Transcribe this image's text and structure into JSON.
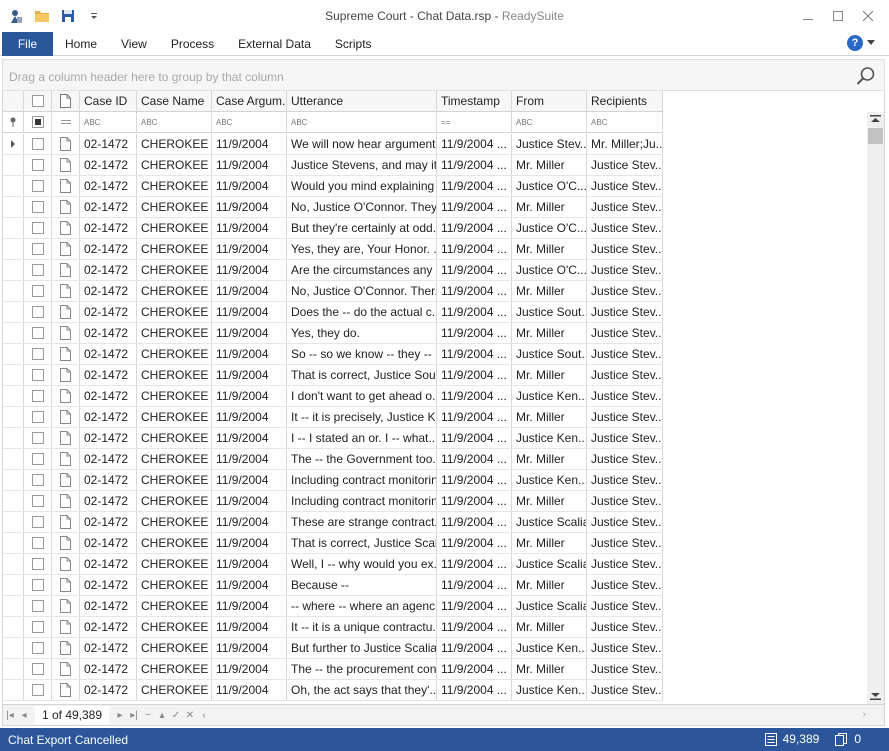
{
  "window": {
    "title": "Supreme Court - Chat Data.rsp",
    "app_name": "ReadySuite"
  },
  "ribbon": {
    "file_label": "File",
    "tabs": [
      "Home",
      "View",
      "Process",
      "External Data",
      "Scripts"
    ]
  },
  "group_panel": {
    "hint": "Drag a column header here to group by that column"
  },
  "grid": {
    "columns": [
      "Case ID",
      "Case Name",
      "Case Argum...",
      "Utterance",
      "Timestamp",
      "From",
      "Recipients"
    ],
    "filter_glyphs": [
      "ABC",
      "ABC",
      "ABC",
      "ABC",
      "==",
      "ABC",
      "ABC"
    ],
    "rows": [
      {
        "id": "02-1472",
        "name": "CHEROKEE ...",
        "date": "11/9/2004",
        "utterance": "We will now hear argument ...",
        "ts": "11/9/2004 ...",
        "from": "Justice Stev...",
        "to": "Mr. Miller;Ju..."
      },
      {
        "id": "02-1472",
        "name": "CHEROKEE ...",
        "date": "11/9/2004",
        "utterance": "Justice Stevens, and may it...",
        "ts": "11/9/2004 ...",
        "from": "Mr. Miller",
        "to": "Justice Stev..."
      },
      {
        "id": "02-1472",
        "name": "CHEROKEE ...",
        "date": "11/9/2004",
        "utterance": "Would you mind explaining ...",
        "ts": "11/9/2004 ...",
        "from": "Justice O'C...",
        "to": "Justice Stev..."
      },
      {
        "id": "02-1472",
        "name": "CHEROKEE ...",
        "date": "11/9/2004",
        "utterance": "No, Justice O'Connor. They...",
        "ts": "11/9/2004 ...",
        "from": "Mr. Miller",
        "to": "Justice Stev..."
      },
      {
        "id": "02-1472",
        "name": "CHEROKEE ...",
        "date": "11/9/2004",
        "utterance": "But they're certainly at odd...",
        "ts": "11/9/2004 ...",
        "from": "Justice O'C...",
        "to": "Justice Stev..."
      },
      {
        "id": "02-1472",
        "name": "CHEROKEE ...",
        "date": "11/9/2004",
        "utterance": "Yes, they are, Your Honor. ...",
        "ts": "11/9/2004 ...",
        "from": "Mr. Miller",
        "to": "Justice Stev..."
      },
      {
        "id": "02-1472",
        "name": "CHEROKEE ...",
        "date": "11/9/2004",
        "utterance": "Are the circumstances any ...",
        "ts": "11/9/2004 ...",
        "from": "Justice O'C...",
        "to": "Justice Stev..."
      },
      {
        "id": "02-1472",
        "name": "CHEROKEE ...",
        "date": "11/9/2004",
        "utterance": "No, Justice O'Connor. Ther...",
        "ts": "11/9/2004 ...",
        "from": "Mr. Miller",
        "to": "Justice Stev..."
      },
      {
        "id": "02-1472",
        "name": "CHEROKEE ...",
        "date": "11/9/2004",
        "utterance": "Does the -- do the actual c...",
        "ts": "11/9/2004 ...",
        "from": "Justice Sout...",
        "to": "Justice Stev..."
      },
      {
        "id": "02-1472",
        "name": "CHEROKEE ...",
        "date": "11/9/2004",
        "utterance": "Yes, they do.",
        "ts": "11/9/2004 ...",
        "from": "Mr. Miller",
        "to": "Justice Stev..."
      },
      {
        "id": "02-1472",
        "name": "CHEROKEE ...",
        "date": "11/9/2004",
        "utterance": "So -- so we know -- they -- ...",
        "ts": "11/9/2004 ...",
        "from": "Justice Sout...",
        "to": "Justice Stev..."
      },
      {
        "id": "02-1472",
        "name": "CHEROKEE ...",
        "date": "11/9/2004",
        "utterance": "That is correct, Justice Sou...",
        "ts": "11/9/2004 ...",
        "from": "Mr. Miller",
        "to": "Justice Stev..."
      },
      {
        "id": "02-1472",
        "name": "CHEROKEE ...",
        "date": "11/9/2004",
        "utterance": "I don't want to get ahead o...",
        "ts": "11/9/2004 ...",
        "from": "Justice Ken...",
        "to": "Justice Stev..."
      },
      {
        "id": "02-1472",
        "name": "CHEROKEE ...",
        "date": "11/9/2004",
        "utterance": "It -- it is precisely, Justice K...",
        "ts": "11/9/2004 ...",
        "from": "Mr. Miller",
        "to": "Justice Stev..."
      },
      {
        "id": "02-1472",
        "name": "CHEROKEE ...",
        "date": "11/9/2004",
        "utterance": "I -- I stated an or. I -- what...",
        "ts": "11/9/2004 ...",
        "from": "Justice Ken...",
        "to": "Justice Stev..."
      },
      {
        "id": "02-1472",
        "name": "CHEROKEE ...",
        "date": "11/9/2004",
        "utterance": "The -- the Government too...",
        "ts": "11/9/2004 ...",
        "from": "Mr. Miller",
        "to": "Justice Stev..."
      },
      {
        "id": "02-1472",
        "name": "CHEROKEE ...",
        "date": "11/9/2004",
        "utterance": "Including contract monitorin...",
        "ts": "11/9/2004 ...",
        "from": "Justice Ken...",
        "to": "Justice Stev..."
      },
      {
        "id": "02-1472",
        "name": "CHEROKEE ...",
        "date": "11/9/2004",
        "utterance": "Including contract monitorin...",
        "ts": "11/9/2004 ...",
        "from": "Mr. Miller",
        "to": "Justice Stev..."
      },
      {
        "id": "02-1472",
        "name": "CHEROKEE ...",
        "date": "11/9/2004",
        "utterance": "These are strange contract...",
        "ts": "11/9/2004 ...",
        "from": "Justice Scalia",
        "to": "Justice Stev..."
      },
      {
        "id": "02-1472",
        "name": "CHEROKEE ...",
        "date": "11/9/2004",
        "utterance": "That is correct, Justice Scali...",
        "ts": "11/9/2004 ...",
        "from": "Mr. Miller",
        "to": "Justice Stev..."
      },
      {
        "id": "02-1472",
        "name": "CHEROKEE ...",
        "date": "11/9/2004",
        "utterance": "Well, I -- why would you ex...",
        "ts": "11/9/2004 ...",
        "from": "Justice Scalia",
        "to": "Justice Stev..."
      },
      {
        "id": "02-1472",
        "name": "CHEROKEE ...",
        "date": "11/9/2004",
        "utterance": "Because --",
        "ts": "11/9/2004 ...",
        "from": "Mr. Miller",
        "to": "Justice Stev..."
      },
      {
        "id": "02-1472",
        "name": "CHEROKEE ...",
        "date": "11/9/2004",
        "utterance": "-- where -- where an agenc...",
        "ts": "11/9/2004 ...",
        "from": "Justice Scalia",
        "to": "Justice Stev..."
      },
      {
        "id": "02-1472",
        "name": "CHEROKEE ...",
        "date": "11/9/2004",
        "utterance": "It -- it is a unique contractu...",
        "ts": "11/9/2004 ...",
        "from": "Mr. Miller",
        "to": "Justice Stev..."
      },
      {
        "id": "02-1472",
        "name": "CHEROKEE ...",
        "date": "11/9/2004",
        "utterance": "But further to Justice Scalia...",
        "ts": "11/9/2004 ...",
        "from": "Justice Ken...",
        "to": "Justice Stev..."
      },
      {
        "id": "02-1472",
        "name": "CHEROKEE ...",
        "date": "11/9/2004",
        "utterance": "The -- the procurement con...",
        "ts": "11/9/2004 ...",
        "from": "Mr. Miller",
        "to": "Justice Stev..."
      },
      {
        "id": "02-1472",
        "name": "CHEROKEE ...",
        "date": "11/9/2004",
        "utterance": "Oh, the act says that they'...",
        "ts": "11/9/2004 ...",
        "from": "Justice Ken...",
        "to": "Justice Stev..."
      }
    ]
  },
  "navigator": {
    "record_text": "1 of 49,389"
  },
  "status": {
    "message": "Chat Export Cancelled",
    "record_count": "49,389",
    "selected_count": "0"
  },
  "colors": {
    "accent": "#2b579a",
    "help": "#2a68c8"
  }
}
